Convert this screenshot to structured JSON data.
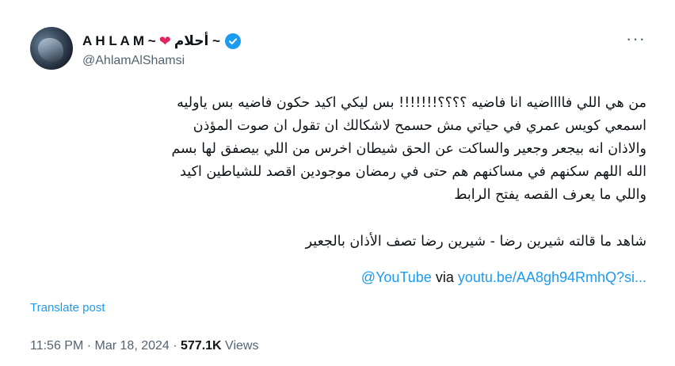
{
  "author": {
    "name_latin": "A H L A M ~",
    "heart": "❤",
    "name_arabic": "~ أحلام",
    "handle": "@AhlamAlShamsi",
    "verified_icon": "verified-badge-icon",
    "more_label": "···"
  },
  "tweet": {
    "lines": [
      "من هي اللي فااااضيه انا فاضيه ؟؟؟؟!!!!!!! بس ليكي اكيد حكون فاضيه بس ياوليه",
      "اسمعي كويس عمري في حياتي مش حسمح لاشكالك ان تقول ان صوت المؤذن",
      "والاذان انه بيجعر وجعير والساكت عن الحق شيطان اخرس من اللي بيصفق لها بسم",
      "الله اللهم سكنهم في مساكنهم هم حتى في رمضان موجودين اقصد للشياطين اكيد",
      "واللي ما يعرف القصه يفتح الرابط"
    ],
    "link_title": "شاهد ما قالته شيرين رضا - شيرين رضا تصف الأذان بالجعير",
    "via_mention": "@YouTube",
    "via_word": "via",
    "link_url": "youtu.be/AA8gh94RmhQ?si..."
  },
  "translate_label": "Translate post",
  "meta": {
    "time": "11:56 PM",
    "sep1": " · ",
    "date": "Mar 18, 2024",
    "sep2": " · ",
    "views_count": "577.1K",
    "views_label": " Views"
  },
  "colors": {
    "accent": "#1d9bf0",
    "heart": "#e0245e",
    "secondary_text": "#536471"
  }
}
